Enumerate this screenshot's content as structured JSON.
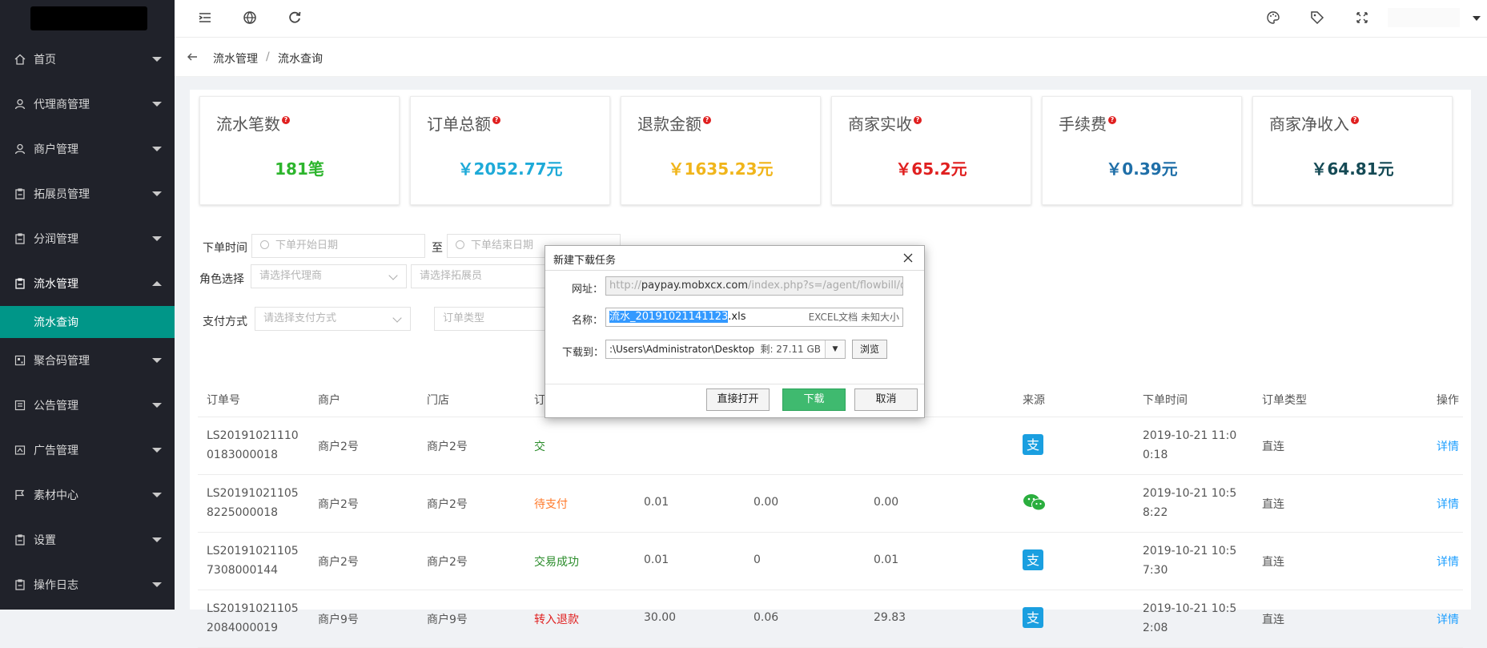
{
  "sidebar": {
    "items": [
      {
        "label": "首页"
      },
      {
        "label": "代理商管理"
      },
      {
        "label": "商户管理"
      },
      {
        "label": "拓展员管理"
      },
      {
        "label": "分润管理"
      },
      {
        "label": "流水管理"
      },
      {
        "label": "聚合码管理"
      },
      {
        "label": "公告管理"
      },
      {
        "label": "广告管理"
      },
      {
        "label": "素材中心"
      },
      {
        "label": "设置"
      },
      {
        "label": "操作日志"
      }
    ],
    "active_sub": "流水查询"
  },
  "breadcrumb": {
    "parent": "流水管理",
    "sep": "/",
    "current": "流水查询"
  },
  "stats": [
    {
      "title": "流水笔数",
      "value": "181笔",
      "color": "#2db52d"
    },
    {
      "title": "订单总额",
      "value": "￥2052.77元",
      "color": "#1eaad8"
    },
    {
      "title": "退款金额",
      "value": "￥1635.23元",
      "color": "#f0b51b"
    },
    {
      "title": "商家实收",
      "value": "￥65.2元",
      "color": "#e02020"
    },
    {
      "title": "手续费",
      "value": "￥0.39元",
      "color": "#1f6fa8"
    },
    {
      "title": "商家净收入",
      "value": "￥64.81元",
      "color": "#154a55"
    }
  ],
  "filters": {
    "order_time_label": "下单时间",
    "start_placeholder": "下单开始日期",
    "to_label": "至",
    "end_placeholder": "下单结束日期",
    "role_label": "角色选择",
    "agent_placeholder": "请选择代理商",
    "expander_placeholder": "请选择拓展员",
    "pay_label": "支付方式",
    "pay_placeholder": "请选择支付方式",
    "order_type_placeholder": "订单类型"
  },
  "table": {
    "headers": {
      "order_no": "订单号",
      "merchant": "商户",
      "store": "门店",
      "status": "订",
      "source": "来源",
      "time": "下单时间",
      "type": "订单类型",
      "action": "操作"
    },
    "rows": [
      {
        "order_no": "LS201910211100183000018",
        "merchant": "商户2号",
        "store": "商户2号",
        "status": "交",
        "status_color": "#2a8c2a",
        "amount": "",
        "fee": "",
        "net": "",
        "source": "alipay-icon",
        "time": "2019-10-21 11:00:18",
        "type": "直连",
        "action": "详情"
      },
      {
        "order_no": "LS201910211058225000018",
        "merchant": "商户2号",
        "store": "商户2号",
        "status": "待支付",
        "status_color": "#ff7a2b",
        "amount": "0.01",
        "fee": "0.00",
        "net": "0.00",
        "source": "wechat-icon",
        "time": "2019-10-21 10:58:22",
        "type": "直连",
        "action": "详情"
      },
      {
        "order_no": "LS201910211057308000144",
        "merchant": "商户2号",
        "store": "商户2号",
        "status": "交易成功",
        "status_color": "#2a8c2a",
        "amount": "0.01",
        "fee": "0",
        "net": "0.01",
        "source": "alipay-icon",
        "time": "2019-10-21 10:57:30",
        "type": "直连",
        "action": "详情"
      },
      {
        "order_no": "LS201910211052084000019",
        "merchant": "商户9号",
        "store": "商户9号",
        "status": "转入退款",
        "status_color": "#e02020",
        "amount": "30.00",
        "fee": "0.06",
        "net": "29.83",
        "source": "alipay-icon",
        "time": "2019-10-21 10:52:08",
        "type": "直连",
        "action": "详情"
      }
    ]
  },
  "dialog": {
    "title": "新建下载任务",
    "url_label": "网址：",
    "url_prefix": "http://",
    "url_host": "paypay.mobxcx.com",
    "url_rest": "/index.php?s=/agent/flowbill/de",
    "name_label": "名称：",
    "name_selected": "流水_20191021141123",
    "name_ext": ".xls",
    "name_type": "EXCEL文档 未知大小",
    "save_label": "下载到：",
    "save_path": ":\\Users\\Administrator\\Desktop",
    "save_free": "剩: 27.11 GB",
    "browse": "浏览",
    "open_btn": "直接打开",
    "download_btn": "下载",
    "cancel_btn": "取消"
  }
}
